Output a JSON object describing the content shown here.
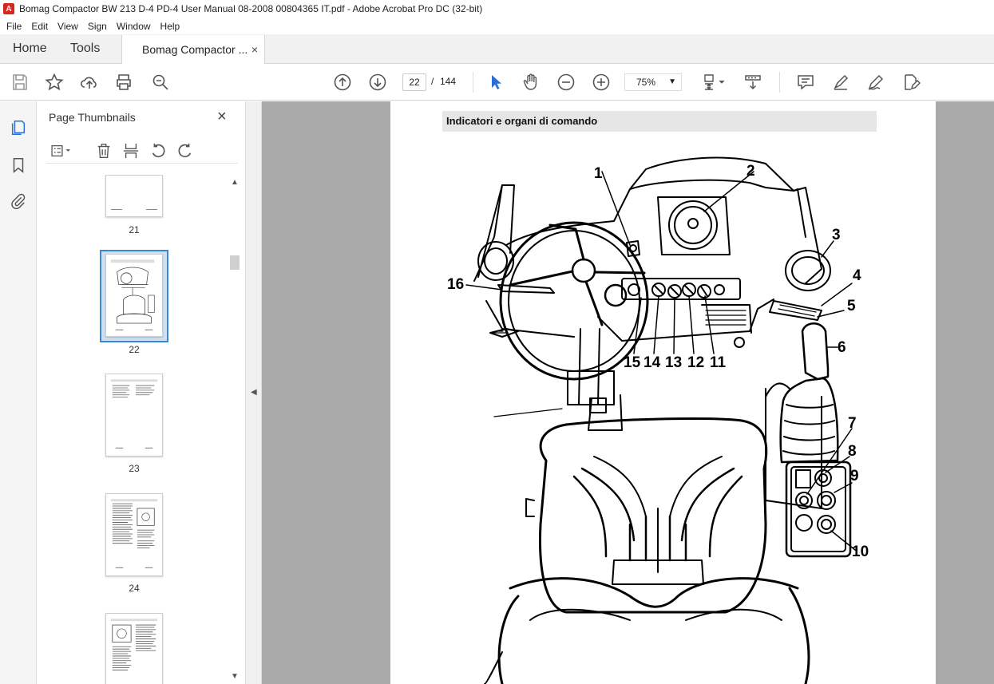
{
  "window": {
    "title": "Bomag Compactor BW 213 D-4 PD-4 User Manual 08-2008 00804365 IT.pdf - Adobe Acrobat Pro DC (32-bit)"
  },
  "menu": [
    "File",
    "Edit",
    "View",
    "Sign",
    "Window",
    "Help"
  ],
  "tabs": {
    "home": "Home",
    "tools": "Tools",
    "document": "Bomag Compactor ...",
    "close": "×"
  },
  "toolbar": {
    "current_page": "22",
    "separator": "/",
    "total_pages": "144",
    "zoom": "75%"
  },
  "thumbnails_panel": {
    "title": "Page Thumbnails",
    "close": "×",
    "pages": [
      {
        "label": "21",
        "selected": false
      },
      {
        "label": "22",
        "selected": true
      },
      {
        "label": "23",
        "selected": false
      },
      {
        "label": "24",
        "selected": false
      },
      {
        "label": "",
        "selected": false
      }
    ]
  },
  "document": {
    "header": "Indicatori e organi di comando",
    "callouts": [
      "1",
      "2",
      "3",
      "4",
      "5",
      "6",
      "7",
      "8",
      "9",
      "10",
      "11",
      "12",
      "13",
      "14",
      "15",
      "16"
    ]
  },
  "colors": {
    "accent": "#3b86d6",
    "viewer_bg": "#aaaaaa",
    "acrobat_red": "#d9261c"
  }
}
